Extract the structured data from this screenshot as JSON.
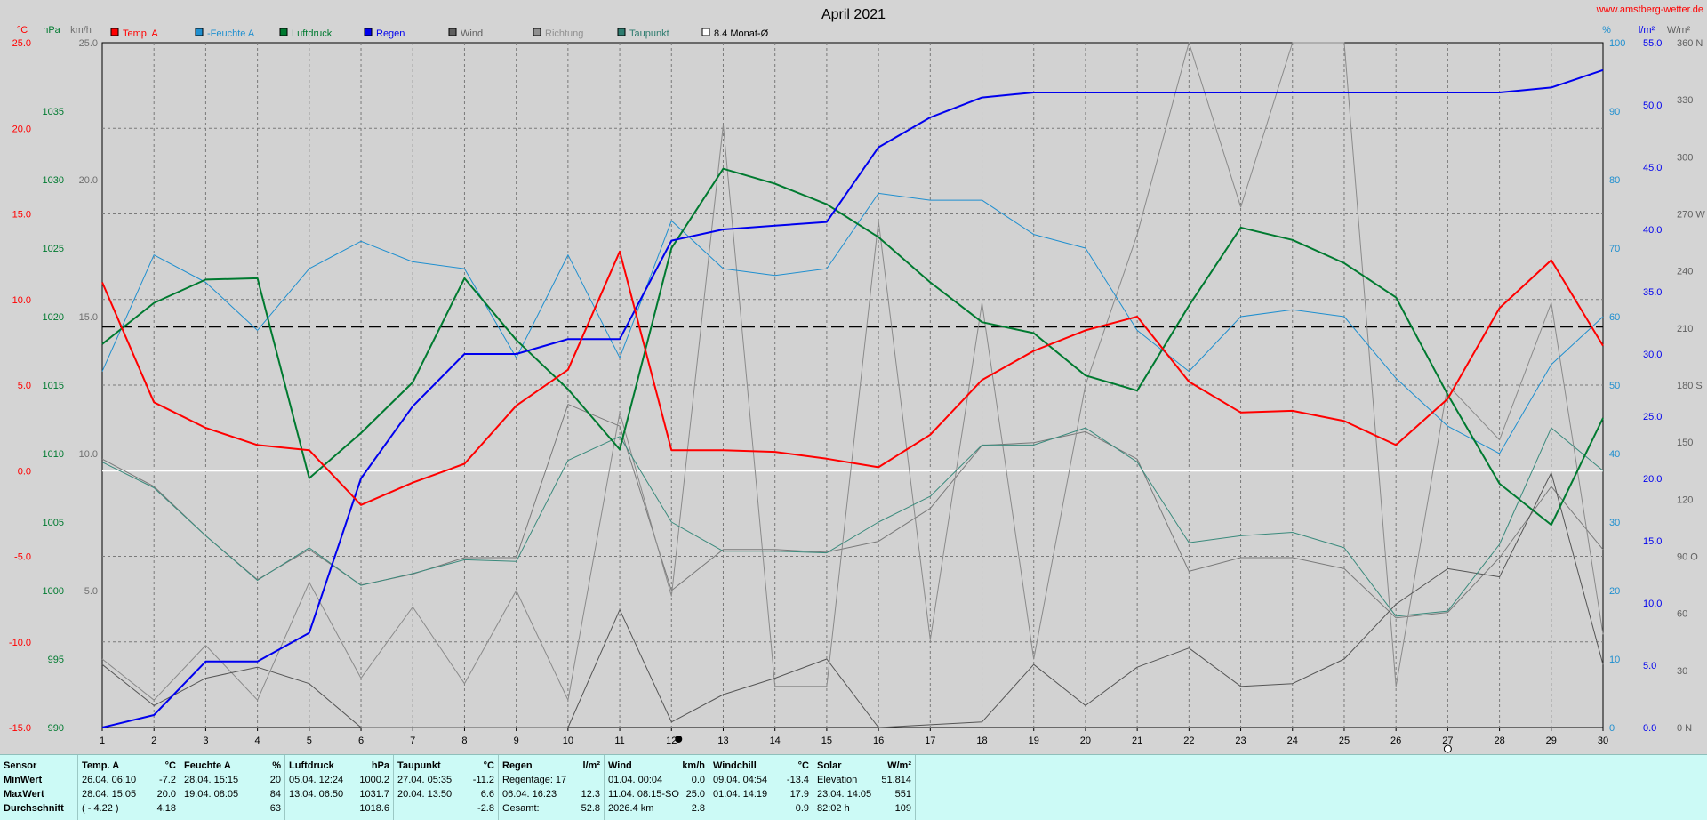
{
  "title": "April 2021",
  "watermark": "www.amstberg-wetter.de",
  "left_units": [
    "°C",
    "hPa",
    "km/h"
  ],
  "right_units": [
    "%",
    "l/m²",
    "W/m²"
  ],
  "legend": [
    {
      "label": "Temp. A",
      "color": "#ff0000"
    },
    {
      "label": "Feuchte A",
      "color": "#1f8fcf",
      "prefix": "-"
    },
    {
      "label": "Luftdruck",
      "color": "#007a30"
    },
    {
      "label": "Regen",
      "color": "#0000ee"
    },
    {
      "label": "Wind",
      "color": "#606060"
    },
    {
      "label": "Richtung",
      "color": "#909090"
    },
    {
      "label": "Taupunkt",
      "color": "#2e7c6f"
    },
    {
      "label": "8.4 Monat-Ø",
      "color": "#000000",
      "box": true
    }
  ],
  "chart_data": {
    "type": "line",
    "title": "April 2021",
    "x": [
      1,
      2,
      3,
      4,
      5,
      6,
      7,
      8,
      9,
      10,
      11,
      12,
      13,
      14,
      15,
      16,
      17,
      18,
      19,
      20,
      21,
      22,
      23,
      24,
      25,
      26,
      27,
      28,
      29,
      30
    ],
    "grid": true,
    "month_average_temp": 8.4,
    "axes": {
      "temp_c": {
        "ylim": [
          -15,
          25
        ],
        "ticks": [
          "25.0",
          "20.0",
          "15.0",
          "10.0",
          "5.0",
          "0.0",
          "-5.0",
          "-10.0",
          "-15.0"
        ],
        "color": "#ff0000"
      },
      "pressure_hpa": {
        "ylim": [
          990,
          1040
        ],
        "ticks": [
          "1035",
          "1030",
          "1025",
          "1020",
          "1015",
          "1010",
          "1005",
          "1000",
          "995",
          "990"
        ],
        "color": "#007a30"
      },
      "wind_kmh": {
        "ylim": [
          0,
          25
        ],
        "ticks": [
          "25.0",
          "20.0",
          "15.0",
          "10.0",
          "5.0"
        ],
        "color": "#707070"
      },
      "humidity_pct": {
        "ylim": [
          0,
          100
        ],
        "ticks": [
          "100",
          "90",
          "80",
          "70",
          "60",
          "50",
          "40",
          "30",
          "20",
          "10",
          "0"
        ],
        "color": "#1f8fcf"
      },
      "rain_lm2": {
        "ylim": [
          0,
          55
        ],
        "ticks": [
          "55.0",
          "50.0",
          "45.0",
          "40.0",
          "35.0",
          "30.0",
          "25.0",
          "20.0",
          "15.0",
          "10.0",
          "5.0",
          "0.0"
        ],
        "color": "#0000ee"
      },
      "solar_w": {
        "ticks": [
          "360 N",
          "330",
          "300",
          "270 W",
          "240",
          "210",
          "180 S",
          "150",
          "120",
          "90 O",
          "60",
          "30",
          "0 N"
        ],
        "color": "#606060"
      }
    },
    "series": [
      {
        "name": "Temp. A",
        "axis": "temp_c",
        "color": "#ff0000",
        "width": 2,
        "values": [
          11.0,
          4.0,
          2.5,
          1.5,
          1.2,
          -2.0,
          -0.7,
          0.4,
          3.8,
          5.9,
          12.8,
          1.2,
          1.2,
          1.1,
          0.7,
          0.2,
          2.1,
          5.3,
          7.0,
          8.2,
          9.0,
          5.2,
          3.4,
          3.5,
          2.9,
          1.5,
          4.2,
          9.5,
          12.3,
          7.3
        ]
      },
      {
        "name": "Feuchte A",
        "axis": "humidity_pct",
        "color": "#1f8fcf",
        "width": 1,
        "values": [
          52,
          69,
          65,
          58,
          67,
          71,
          68,
          67,
          54,
          69,
          54,
          74,
          67,
          66,
          67,
          78,
          77,
          77,
          72,
          70,
          58,
          52,
          60,
          61,
          60,
          51,
          44,
          40,
          53,
          60
        ]
      },
      {
        "name": "Luftdruck",
        "axis": "pressure_hpa",
        "color": "#007a30",
        "width": 2,
        "values": [
          1018.0,
          1021.0,
          1022.7,
          1022.8,
          1008.2,
          1011.5,
          1015.2,
          1022.8,
          1018.3,
          1014.7,
          1010.3,
          1025.0,
          1030.8,
          1029.7,
          1028.2,
          1025.8,
          1022.5,
          1019.6,
          1018.8,
          1015.7,
          1014.6,
          1020.8,
          1026.5,
          1025.6,
          1023.9,
          1021.4,
          1014.3,
          1007.8,
          1004.8,
          1012.6
        ]
      },
      {
        "name": "Regen",
        "axis": "rain_lm2",
        "color": "#0000ee",
        "width": 2,
        "values": [
          0.0,
          1.0,
          5.3,
          5.3,
          7.6,
          20.0,
          25.8,
          30.0,
          30.0,
          31.2,
          31.2,
          39.1,
          40.0,
          40.3,
          40.6,
          46.6,
          49.0,
          50.6,
          51.0,
          51.0,
          51.0,
          51.0,
          51.0,
          51.0,
          51.0,
          51.0,
          51.0,
          51.0,
          51.4,
          52.8
        ]
      },
      {
        "name": "Wind",
        "axis": "wind_kmh",
        "color": "#555555",
        "width": 1,
        "values": [
          2.3,
          0.8,
          1.8,
          2.2,
          1.6,
          0.0,
          0.0,
          0.0,
          0.0,
          0.0,
          4.3,
          0.2,
          1.2,
          1.8,
          2.5,
          0.0,
          0.1,
          0.2,
          2.3,
          0.8,
          2.2,
          2.9,
          1.5,
          1.6,
          2.5,
          4.5,
          5.8,
          5.5,
          9.3,
          2.3
        ]
      },
      {
        "name": "Richtung",
        "axis": "wind_kmh",
        "color": "#8a8a8a",
        "width": 1,
        "values": [
          2.5,
          1.0,
          3.0,
          1.0,
          5.3,
          1.8,
          4.4,
          1.6,
          5.0,
          1.0,
          11.5,
          4.8,
          22.0,
          1.5,
          1.5,
          18.5,
          3.2,
          15.5,
          2.5,
          12.5,
          18.0,
          25.0,
          19.0,
          25.0,
          25.0,
          1.5,
          12.5,
          10.5,
          15.5,
          3.4
        ]
      },
      {
        "name": "Wind2",
        "axis": "wind_kmh",
        "color": "#7a7a7a",
        "width": 1,
        "values": [
          9.8,
          8.8,
          7.0,
          5.4,
          6.5,
          5.2,
          5.6,
          6.2,
          6.2,
          11.8,
          11.0,
          5.0,
          6.5,
          6.5,
          6.4,
          6.8,
          8.0,
          10.3,
          10.4,
          10.8,
          9.8,
          5.7,
          6.2,
          6.2,
          5.8,
          4.0,
          4.2,
          6.2,
          8.8,
          6.5
        ]
      },
      {
        "name": "Taupunkt",
        "axis": "temp_c",
        "color": "#3a8a7c",
        "width": 1,
        "values": [
          0.5,
          -1.0,
          -3.8,
          -6.4,
          -4.5,
          -6.7,
          -6.0,
          -5.2,
          -5.3,
          0.6,
          2.0,
          -3.0,
          -4.7,
          -4.7,
          -4.8,
          -3.0,
          -1.5,
          1.5,
          1.5,
          2.5,
          0.5,
          -4.2,
          -3.8,
          -3.6,
          -4.5,
          -8.5,
          -8.2,
          -4.3,
          2.5,
          0.0
        ]
      }
    ]
  },
  "stats": {
    "sensor": {
      "header": "Sensor",
      "rows": [
        "MinWert",
        "MaxWert",
        "Durchschnitt"
      ]
    },
    "blocks": [
      {
        "label": "Temp. A",
        "unit": "°C",
        "rows": [
          {
            "when": "26.04.  06:10",
            "value": "-7.2"
          },
          {
            "when": "28.04.  15:05",
            "value": "20.0"
          },
          {
            "when": "( - 4.22 )",
            "value": "4.18"
          }
        ]
      },
      {
        "label": "Feuchte A",
        "unit": "%",
        "rows": [
          {
            "when": "28.04.  15:15",
            "value": "20"
          },
          {
            "when": "19.04.  08:05",
            "value": "84"
          },
          {
            "when": "",
            "value": "63"
          }
        ]
      },
      {
        "label": "Luftdruck",
        "unit": "hPa",
        "rows": [
          {
            "when": "05.04.  12:24",
            "value": "1000.2"
          },
          {
            "when": "13.04.  06:50",
            "value": "1031.7"
          },
          {
            "when": "",
            "value": "1018.6"
          }
        ]
      },
      {
        "label": "Taupunkt",
        "unit": "°C",
        "rows": [
          {
            "when": "27.04.  05:35",
            "value": "-11.2"
          },
          {
            "when": "20.04.  13:50",
            "value": "6.6"
          },
          {
            "when": "",
            "value": "-2.8"
          }
        ]
      },
      {
        "label": "Regen",
        "unit": "l/m²",
        "rows": [
          {
            "when": "Regentage: 17",
            "value": ""
          },
          {
            "when": "06.04.  16:23",
            "value": "12.3"
          },
          {
            "when": "Gesamt:",
            "value": "52.8"
          }
        ]
      },
      {
        "label": "Wind",
        "unit": "km/h",
        "rows": [
          {
            "when": "01.04.  00:04",
            "value": "0.0"
          },
          {
            "when": "11.04.  08:15-SO",
            "value": "25.0"
          },
          {
            "when": "2026.4 km",
            "value": "2.8"
          }
        ]
      },
      {
        "label": "Windchill",
        "unit": "°C",
        "rows": [
          {
            "when": "09.04.  04:54",
            "value": "-13.4"
          },
          {
            "when": "01.04.  14:19",
            "value": "17.9"
          },
          {
            "when": "",
            "value": "0.9"
          }
        ]
      },
      {
        "label": "Solar",
        "unit": "W/m²",
        "rows": [
          {
            "when": "Elevation",
            "value": "51.814"
          },
          {
            "when": "23.04.  14:05",
            "value": "551"
          },
          {
            "when": "82:02 h",
            "value": "109"
          }
        ]
      }
    ]
  }
}
